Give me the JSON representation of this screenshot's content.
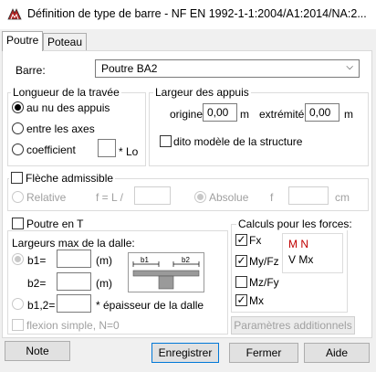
{
  "window": {
    "title": "Définition de type de barre - NF EN 1992-1-1:2004/A1:2014/NA:2...",
    "icon": "bar-definition-icon"
  },
  "tabs": [
    {
      "label": "Poutre",
      "active": true
    },
    {
      "label": "Poteau",
      "active": false
    }
  ],
  "barre": {
    "label": "Barre:",
    "selected": "Poutre BA2"
  },
  "longueur": {
    "title": "Longueur de la travée",
    "options": [
      "au nu des appuis",
      "entre les axes",
      "coefficient"
    ],
    "selected_index": 0,
    "coefficient_value": "",
    "coefficient_unit": "* Lo"
  },
  "largeur": {
    "title": "Largeur des appuis",
    "origine_label": "origine",
    "origine_value": "0,00",
    "origine_unit": "m",
    "extremite_label": "extrémité",
    "extremite_value": "0,00",
    "extremite_unit": "m",
    "dito_label": "dito modèle de la structure",
    "dito_checked": false
  },
  "fleche": {
    "label": "Flèche admissible",
    "checked": false,
    "relative_label": "Relative",
    "formula_label": "f = L /",
    "relative_value": "",
    "absolue_label": "Absolue",
    "f_label": "f",
    "absolue_value": "",
    "unit": "cm",
    "selected": "absolue"
  },
  "poutre_t": {
    "label": "Poutre en T",
    "checked": false,
    "largeurs_title": "Largeurs max de la dalle:",
    "b1_label": "b1=",
    "b1_value": "",
    "b1_unit": "(m)",
    "b2_label": "b2=",
    "b2_value": "",
    "b2_unit": "(m)",
    "b12_label": "b1,2=",
    "b12_value": "",
    "b12_suffix": "* épaisseur de la dalle",
    "flexion_label": "flexion simple, N=0",
    "flexion_checked": false,
    "diagram": {
      "b1": "b1",
      "b2": "b2"
    }
  },
  "calculs": {
    "title": "Calculs pour les forces:",
    "items": [
      {
        "label": "Fx",
        "checked": true
      },
      {
        "label": "My/Fz",
        "checked": true
      },
      {
        "label": "Mz/Fy",
        "checked": false
      },
      {
        "label": "Mx",
        "checked": true
      }
    ],
    "list": [
      {
        "text": "M N",
        "color": "#c00000"
      },
      {
        "text": "V Mx",
        "color": "#000000"
      }
    ],
    "params_label": "Paramètres additionnels"
  },
  "buttons": {
    "note": "Note",
    "save": "Enregistrer",
    "close": "Fermer",
    "help": "Aide"
  }
}
